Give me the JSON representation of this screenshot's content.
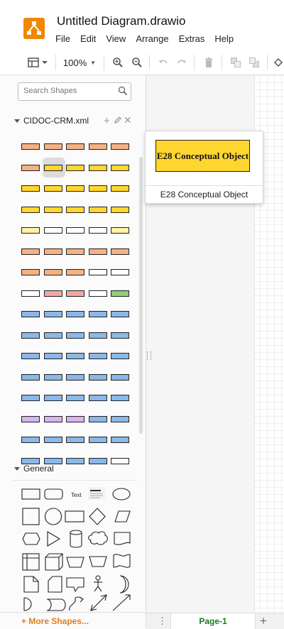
{
  "app": {
    "title": "Untitled Diagram.drawio",
    "menu": [
      "File",
      "Edit",
      "View",
      "Arrange",
      "Extras",
      "Help"
    ]
  },
  "toolbar": {
    "zoom": "100%",
    "icons": [
      "format-panel-icon",
      "zoom-in-icon",
      "zoom-out-icon",
      "undo-icon",
      "redo-icon",
      "delete-icon",
      "to-front-icon",
      "to-back-icon",
      "fill-color-icon"
    ]
  },
  "sidebar": {
    "search_placeholder": "Search Shapes",
    "sections": [
      {
        "label": "CIDOC-CRM.xml",
        "actions": [
          "add-icon",
          "edit-icon",
          "close-icon"
        ]
      },
      {
        "label": "General"
      }
    ],
    "more_shapes": "+ More Shapes..."
  },
  "tooltip": {
    "shape_text": "E28 Conceptual Object",
    "label": "E28 Conceptual Object"
  },
  "tabs": {
    "page": "Page-1",
    "add": "+",
    "menu": "⋮"
  },
  "colors": {
    "logo": "#f08705",
    "peach": "#f4b183",
    "yellow": "#ffd62f",
    "lightyellow": "#fff2a8",
    "pink": "#f4a6a6",
    "green": "#8fce7a",
    "blue": "#8ab8e8",
    "purple": "#d9b3f2",
    "white": "#ffffff",
    "page_tab_text": "#1a7a1a",
    "more_shapes": "#e17e1a"
  }
}
